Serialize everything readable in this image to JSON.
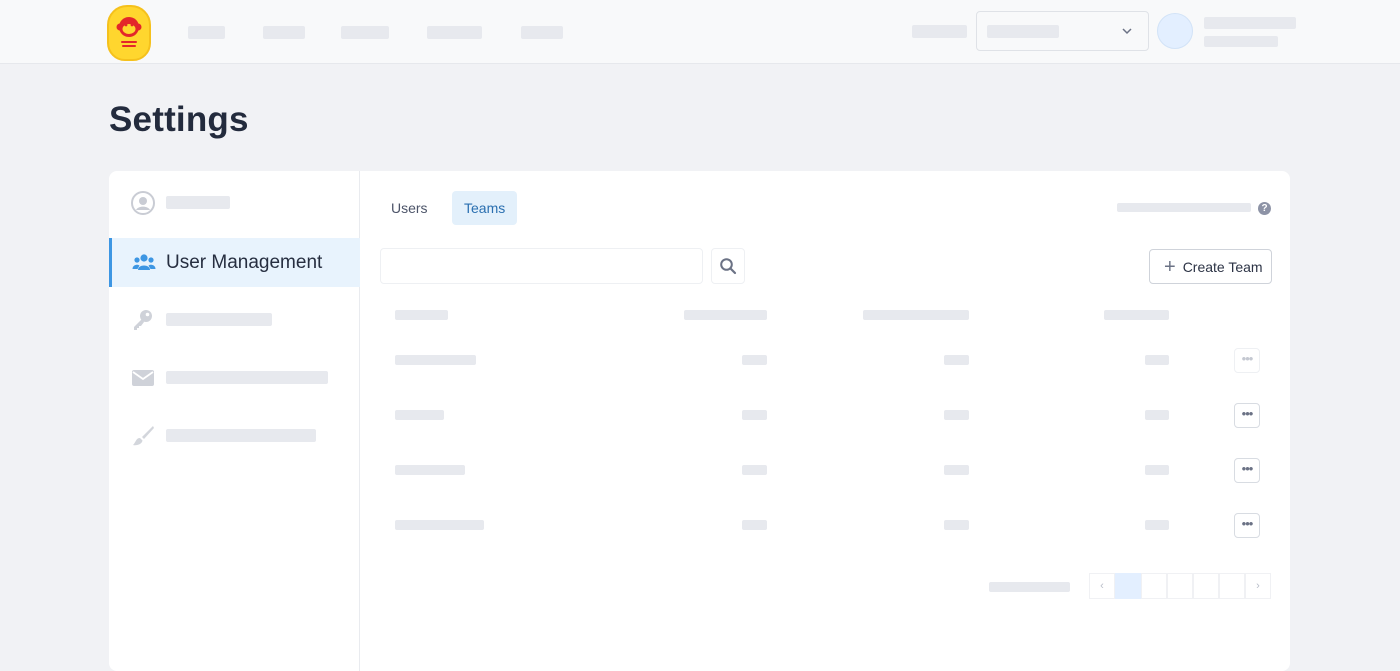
{
  "page": {
    "title": "Settings"
  },
  "sidebar": {
    "active_label": "User Management"
  },
  "tabs": [
    {
      "label": "Users",
      "active": false
    },
    {
      "label": "Teams",
      "active": true
    }
  ],
  "toolbar": {
    "create_label": "Create Team"
  },
  "pagination": {
    "prev": "‹",
    "next": "›"
  },
  "icons": {
    "profile": "person-icon",
    "users": "users-icon",
    "key": "key-icon",
    "mail": "envelope-icon",
    "brush": "brush-icon",
    "search": "search-icon",
    "help": "question-icon",
    "dropdown": "chevron-down-icon"
  },
  "colors": {
    "accent": "#3d96e3",
    "active_tab_bg": "#e3f0fb",
    "logo_yellow": "#ffd62e",
    "logo_red": "#e3262a"
  }
}
